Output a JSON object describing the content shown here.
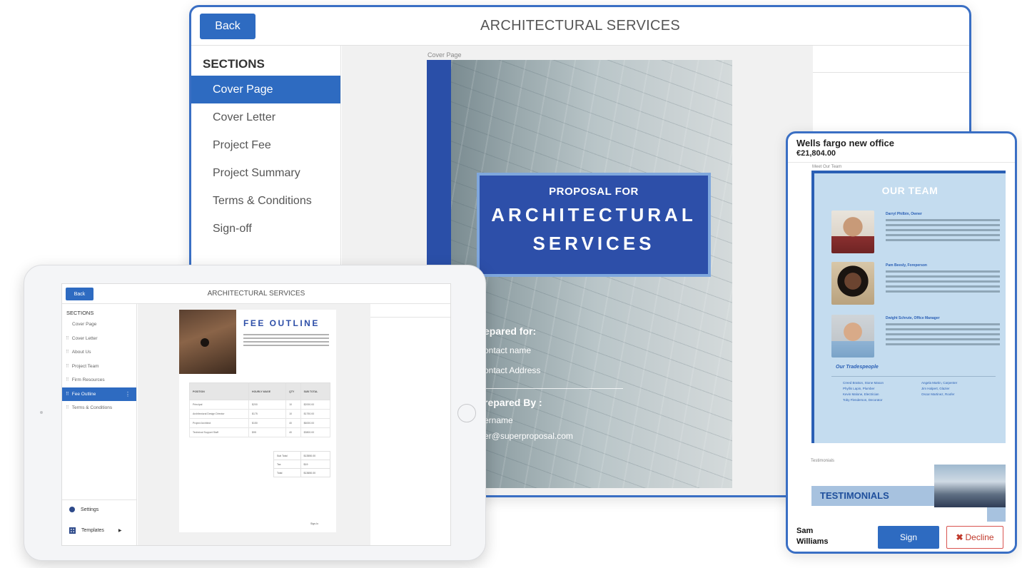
{
  "desktop": {
    "back_label": "Back",
    "title": "ARCHITECTURAL SERVICES",
    "sections_heading": "SECTIONS",
    "sections": [
      {
        "label": "Cover Page",
        "active": true
      },
      {
        "label": "Cover Letter",
        "active": false
      },
      {
        "label": "Project Fee",
        "active": false
      },
      {
        "label": "Project Summary",
        "active": false
      },
      {
        "label": "Terms & Conditions",
        "active": false
      },
      {
        "label": "Sign-off",
        "active": false
      }
    ],
    "canvas_label": "Cover Page",
    "cover": {
      "pre_title": "PROPOSAL FOR",
      "main_title_line1": "ARCHITECTURAL",
      "main_title_line2": "SERVICES",
      "prepared_for": "epared for:",
      "contact_name": "ontact name",
      "contact_address": "ontact Address",
      "prepared_by": "repared By :",
      "username": "ername",
      "email": "er@superproposal.com"
    }
  },
  "phone": {
    "proposal_name": "Wells fargo new office",
    "amount": "€21,804.00",
    "meet_label": "Meet Our Team",
    "team_heading": "OUR TEAM",
    "members": [
      {
        "name": "Darryl Philbin, Owner"
      },
      {
        "name": "Pam Beesly, Foreperson"
      },
      {
        "name": "Dwight Schrute, Office Manager"
      }
    ],
    "tradespeople_heading": "Our Tradespeople",
    "tradespeople_col1": [
      "Creed Bratton, Stone Mason",
      "Phyllis Lapin, Plumber",
      "Kevin Malone, Electrician",
      "Toby Flenderson, Decorator"
    ],
    "tradespeople_col2": [
      "Angela Martin, Carpenter",
      "Jim Halpert, Glazier",
      "Oscar Martinez, Roofer"
    ],
    "testimonials_label": "Testimonials",
    "testimonials_heading": "TESTIMONIALS",
    "signer_name": "Sam Williams",
    "sign_label": "Sign",
    "decline_label": "Decline",
    "decline_icon": "x-icon",
    "accent_color": "#2e6bc1"
  },
  "tablet": {
    "back_label": "Back",
    "title": "ARCHITECTURAL SERVICES",
    "sections_heading": "SECTIONS",
    "sections": [
      {
        "label": "Cover Page",
        "active": false
      },
      {
        "label": "Cover Letter",
        "active": false
      },
      {
        "label": "About Us",
        "active": false
      },
      {
        "label": "Project Team",
        "active": false
      },
      {
        "label": "Firm Resources",
        "active": false
      },
      {
        "label": "Fee Outline",
        "active": true
      },
      {
        "label": "Terms & Conditions",
        "active": false
      }
    ],
    "settings_label": "Settings",
    "templates_label": "Templates",
    "fee_heading": "FEE OUTLINE",
    "table_headers": [
      "POSITION",
      "HOURLY WAGE",
      "QTY",
      "SUB TOTAL"
    ],
    "table_rows": [
      [
        "Principal",
        "$200",
        "10",
        "$2000.00"
      ],
      [
        "Architectural Design Director",
        "$175",
        "10",
        "$1750.00"
      ],
      [
        "Project Architect",
        "$150",
        "40",
        "$6000.00"
      ],
      [
        "Technical Support Staff",
        "$95",
        "40",
        "$3800.00"
      ]
    ],
    "totals": [
      [
        "Sub Total",
        "$13550.00"
      ],
      [
        "Tax",
        "$19"
      ],
      [
        "Total",
        "$13650.00"
      ]
    ],
    "sign_off": "Sign-Io"
  }
}
